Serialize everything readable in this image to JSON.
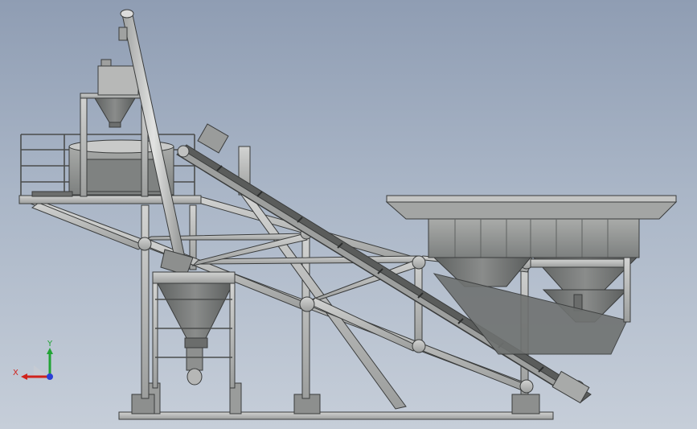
{
  "axes_triad": {
    "x_label": "X",
    "y_label": "Y",
    "x_color": "#d0221c",
    "y_color": "#22a336",
    "z_color": "#2a3fd6"
  },
  "colors": {
    "background_top": "#8f9db3",
    "background_bottom": "#c6ced9",
    "steel": "#b9bab9",
    "steel_dark": "#6f7271",
    "outline": "#3a3c3c"
  },
  "components": [
    "batching-plant-frame",
    "cement-screw-conveyor",
    "mixer-platform",
    "inclined-belt-conveyor",
    "aggregate-bins",
    "weigh-hopper",
    "base-rail"
  ]
}
